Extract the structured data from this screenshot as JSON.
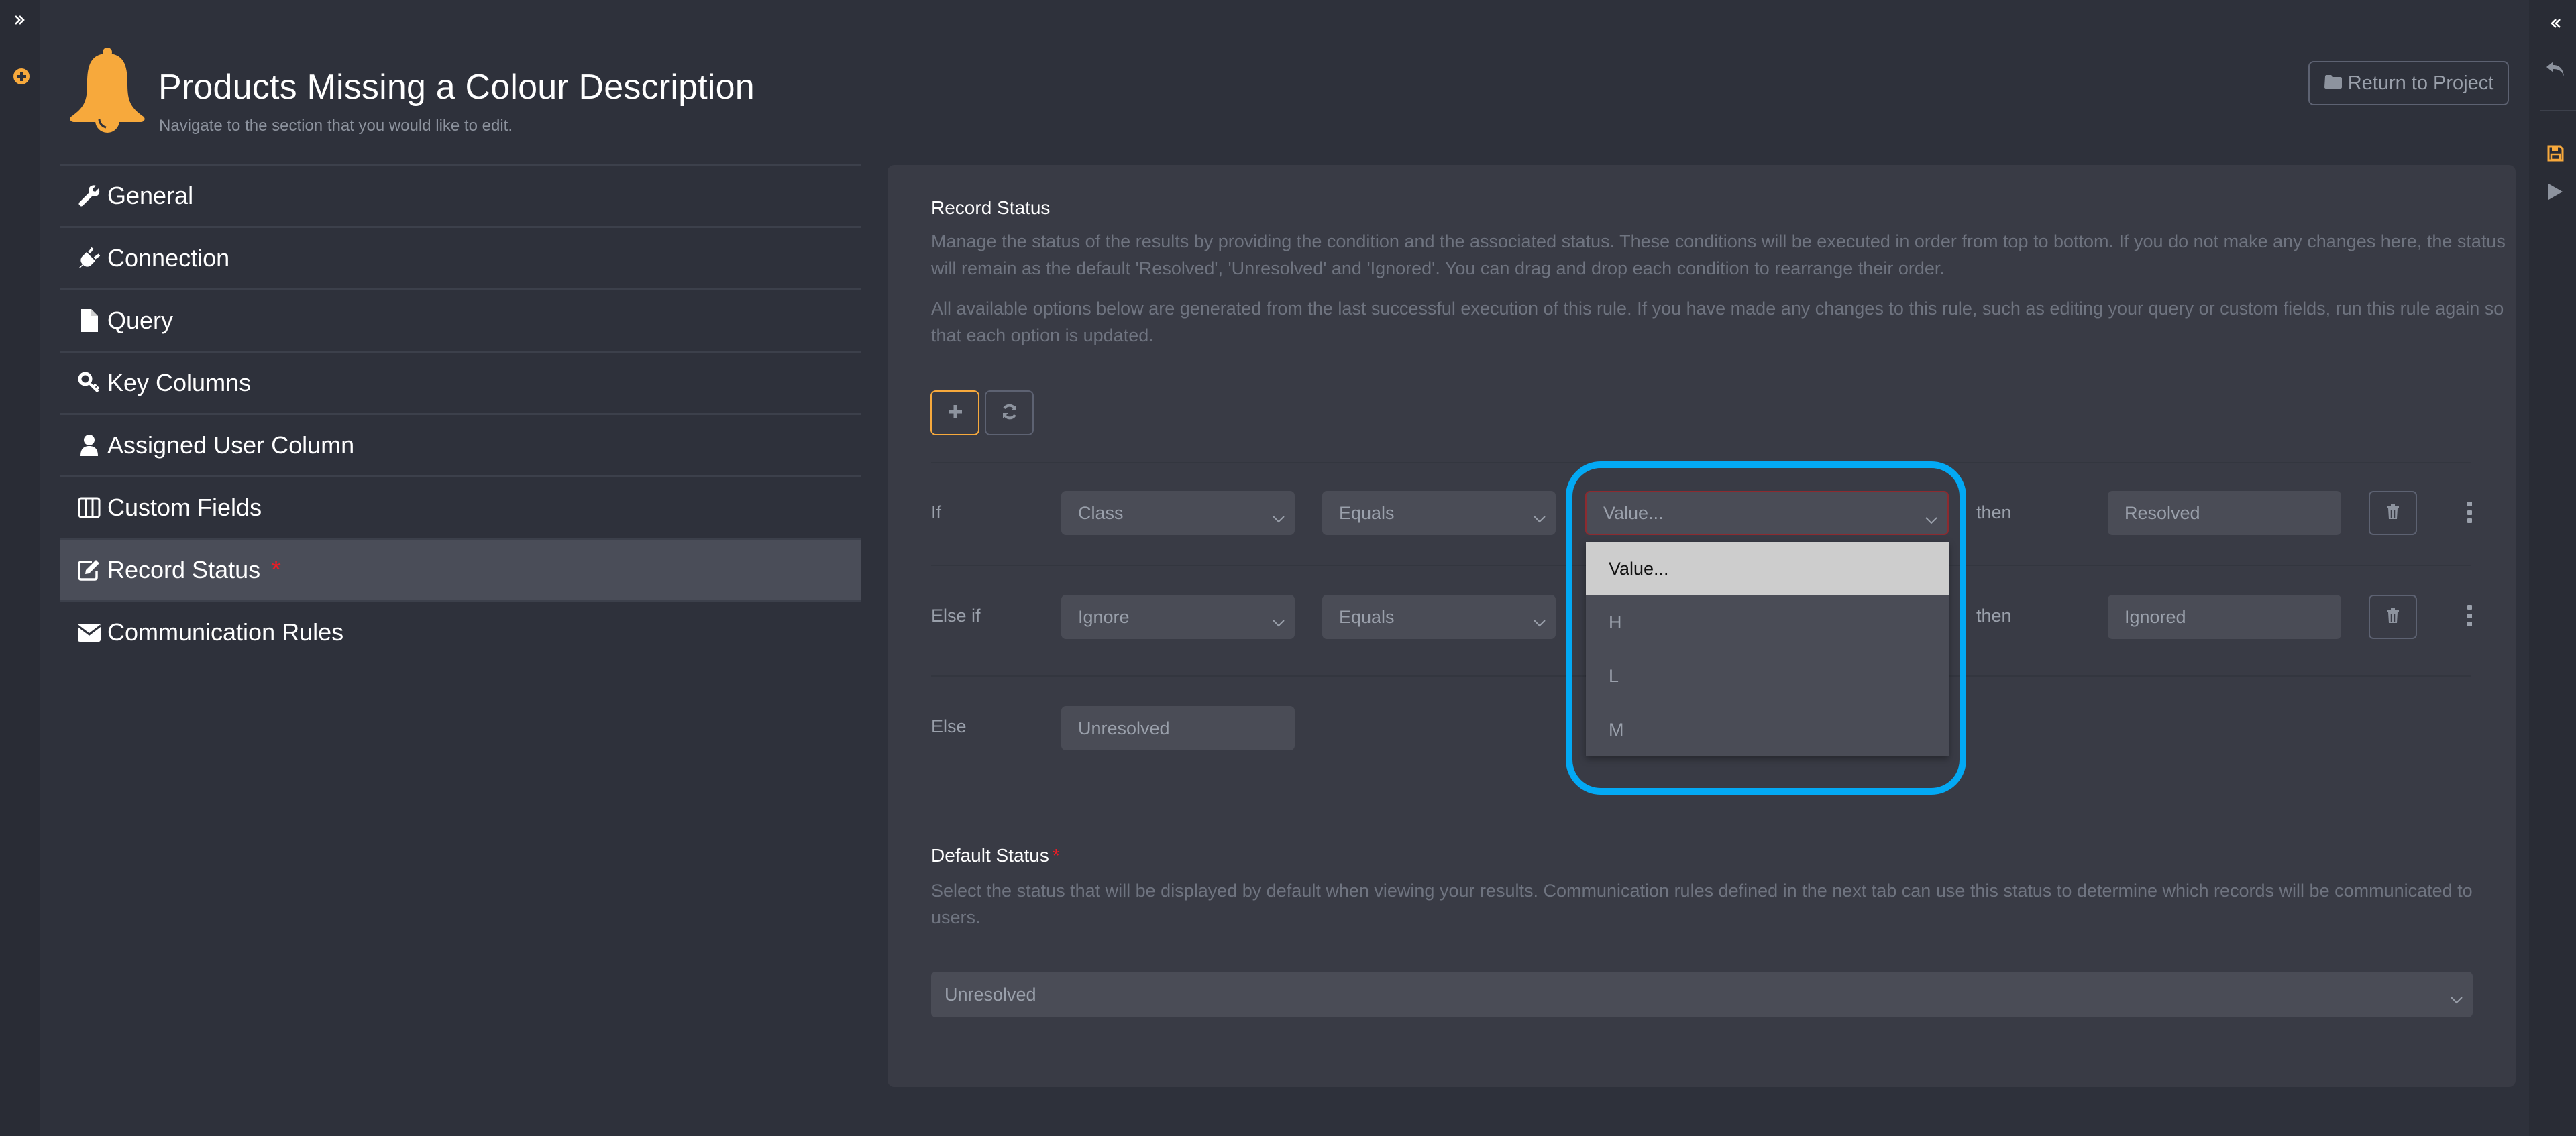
{
  "header": {
    "title": "Products Missing a Colour Description",
    "subtitle": "Navigate to the section that you would like to edit.",
    "icon": "bell-icon",
    "return_button": "Return to Project"
  },
  "left_rail": {
    "expand_icon": "double-chevron-right-icon",
    "add_icon": "plus-circle-icon"
  },
  "right_rail": {
    "collapse_icon": "double-chevron-left-icon",
    "undo_icon": "undo-icon",
    "save_icon": "save-icon",
    "run_icon": "play-icon"
  },
  "sidebar": {
    "items": [
      {
        "label": "General",
        "icon": "wrench-icon"
      },
      {
        "label": "Connection",
        "icon": "plug-icon"
      },
      {
        "label": "Query",
        "icon": "file-icon"
      },
      {
        "label": "Key Columns",
        "icon": "key-icon"
      },
      {
        "label": "Assigned User Column",
        "icon": "user-icon"
      },
      {
        "label": "Custom Fields",
        "icon": "columns-icon"
      },
      {
        "label": "Record Status",
        "icon": "edit-icon",
        "active": true,
        "required": "*"
      },
      {
        "label": "Communication Rules",
        "icon": "envelope-icon"
      }
    ]
  },
  "record_status": {
    "heading": "Record Status",
    "desc1": "Manage the status of the results by providing the condition and the associated status. These conditions will be executed in order from top to bottom. If you do not make any changes here, the status will remain as the default 'Resolved', 'Unresolved' and 'Ignored'. You can drag and drop each condition to rearrange their order.",
    "desc2": "All available options below are generated from the last successful execution of this rule. If you have made any changes to this rule, such as editing your query or custom fields, run this rule again so that each option is updated.",
    "add_button_icon": "plus-icon",
    "refresh_button_icon": "refresh-icon",
    "rules": [
      {
        "label": "If",
        "field": "Class",
        "operator": "Equals",
        "value": "Value...",
        "then": "then",
        "status": "Resolved"
      },
      {
        "label": "Else if",
        "field": "Ignore",
        "operator": "Equals",
        "value": "",
        "then": "then",
        "status": "Ignored"
      }
    ],
    "else_label": "Else",
    "else_status": "Unresolved",
    "value_dropdown": {
      "options": [
        "Value...",
        "H",
        "L",
        "M"
      ],
      "selected": "Value..."
    }
  },
  "default_status": {
    "heading": "Default Status",
    "required": "*",
    "desc": "Select the status that will be displayed by default when viewing your results. Communication rules defined in the next tab can use this status to determine which records will be communicated to users.",
    "value": "Unresolved"
  },
  "colors": {
    "accent": "#f7a93c",
    "highlight": "#03a9f4",
    "required": "#ee1c25",
    "invalid_border": "#8c2b30"
  }
}
